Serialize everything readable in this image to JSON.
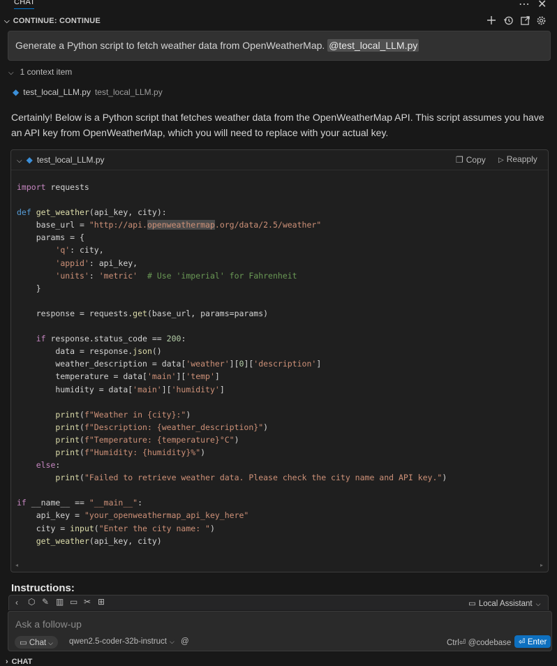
{
  "panel": {
    "tab_label": "CHAT",
    "more_icon": "ellipsis-icon",
    "close_icon": "close-icon"
  },
  "header": {
    "title": "CONTINUE: CONTINUE",
    "actions": [
      "new-session-icon",
      "history-icon",
      "open-in-editor-icon",
      "settings-icon"
    ]
  },
  "prompt": {
    "text": "Generate a Python script to fetch weather data from OpenWeatherMap. ",
    "mention": "@test_local_LLM.py"
  },
  "context": {
    "label": "1 context item",
    "file_name": "test_local_LLM.py",
    "file_path": "test_local_LLM.py"
  },
  "answer": {
    "intro": "Certainly! Below is a Python script that fetches weather data from the OpenWeatherMap API. This script assumes you have an API key from OpenWeatherMap, which you will need to replace with your actual key."
  },
  "code_block": {
    "file_name": "test_local_LLM.py",
    "copy_label": "Copy",
    "reapply_label": "Reapply",
    "language": "python"
  },
  "instructions_heading": "Instructions:",
  "toolbar": {
    "icons": [
      "back-icon",
      "cube-icon",
      "pencil-icon",
      "book-icon",
      "comment-icon",
      "tools-icon",
      "grid-icon"
    ],
    "assistant_label": "Local Assistant"
  },
  "input": {
    "placeholder": "Ask a follow-up",
    "mode_label": "Chat",
    "model_label": "qwen2.5-coder-32b-instruct",
    "at_symbol": "@",
    "codebase_label": "Ctrl⏎ @codebase",
    "enter_label": "⏎ Enter"
  },
  "bottom_section": "CHAT",
  "colors": {
    "background": "#181818",
    "accent": "#0e70c0",
    "keyword": "#569cd6",
    "string": "#ce9178",
    "function": "#dcdcaa",
    "comment": "#6a9955"
  }
}
